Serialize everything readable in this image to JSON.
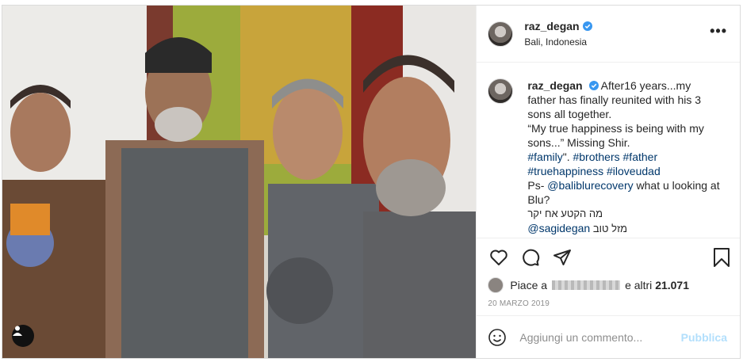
{
  "post": {
    "author": {
      "username": "raz_degan",
      "location": "Bali, Indonesia"
    },
    "menu_icon": "more-horizontal-icon",
    "caption": {
      "username": "raz_degan",
      "line1": "After16 years...my father has finally reunited with his 3 sons all together.",
      "line2": "“My true happiness is being with my sons...” Missing Shir.",
      "hashtags": [
        {
          "text": "#family"
        },
        {
          "text": "#brothers"
        },
        {
          "text": "#father"
        },
        {
          "text": "#truehappiness"
        },
        {
          "text": "#iloveudad"
        }
      ],
      "hashtag_sep": "\".",
      "ps_prefix": "Ps- ",
      "ps_mention": "@baliblurecovery",
      "ps_suffix": " what u looking at Blu?",
      "hebrew_line": "מה הקטע אח יקר",
      "mention_bottom": "@sagidegan",
      "hebrew_tail": " מזל טוב"
    },
    "likes": {
      "prefix": "Piace a",
      "suffix": "e altri",
      "count": "21.071"
    },
    "date": "20 MARZO 2019",
    "comment": {
      "placeholder": "Aggiungi un commento...",
      "publish_label": "Pubblica"
    },
    "icons": {
      "like": "heart-icon",
      "comment": "comment-icon",
      "share": "share-icon",
      "save": "bookmark-icon",
      "emoji": "emoji-icon",
      "tags": "user-tag-icon"
    },
    "colors": {
      "link": "#00376b",
      "verified": "#3897f0",
      "publish": "#b2dffc",
      "muted": "#8e8e8e"
    }
  }
}
